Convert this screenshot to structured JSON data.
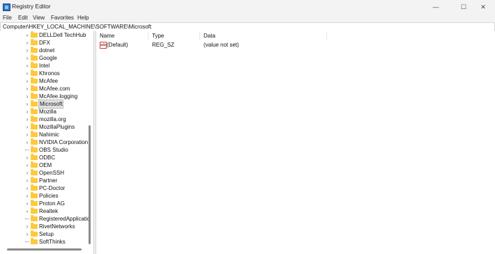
{
  "window": {
    "title": "Registry Editor"
  },
  "window_controls": {
    "minimize": "—",
    "maximize": "☐",
    "close": "✕"
  },
  "menu": [
    {
      "label": "File"
    },
    {
      "label": "Edit"
    },
    {
      "label": "View"
    },
    {
      "label": "Favorites"
    },
    {
      "label": "Help"
    }
  ],
  "address": "Computer\\HKEY_LOCAL_MACHINE\\SOFTWARE\\Microsoft",
  "tree": {
    "selected": "Microsoft",
    "items": [
      {
        "label": "DELLDell TechHub",
        "expandable": true
      },
      {
        "label": "DFX",
        "expandable": true
      },
      {
        "label": "dotnet",
        "expandable": true
      },
      {
        "label": "Google",
        "expandable": true
      },
      {
        "label": "Intel",
        "expandable": true
      },
      {
        "label": "Khronos",
        "expandable": true
      },
      {
        "label": "McAfee",
        "expandable": true
      },
      {
        "label": "McAfee.com",
        "expandable": true
      },
      {
        "label": "McAfee.logging",
        "expandable": true
      },
      {
        "label": "Microsoft",
        "expandable": true
      },
      {
        "label": "Mozilla",
        "expandable": true
      },
      {
        "label": "mozilla.org",
        "expandable": true
      },
      {
        "label": "MozillaPlugins",
        "expandable": true
      },
      {
        "label": "Nahimic",
        "expandable": true
      },
      {
        "label": "NVIDIA Corporation",
        "expandable": true
      },
      {
        "label": "OBS Studio",
        "expandable": false
      },
      {
        "label": "ODBC",
        "expandable": true
      },
      {
        "label": "OEM",
        "expandable": true
      },
      {
        "label": "OpenSSH",
        "expandable": true
      },
      {
        "label": "Partner",
        "expandable": true
      },
      {
        "label": "PC-Doctor",
        "expandable": true
      },
      {
        "label": "Policies",
        "expandable": true
      },
      {
        "label": "Proton AG",
        "expandable": true
      },
      {
        "label": "Realtek",
        "expandable": true
      },
      {
        "label": "RegisteredApplicatic",
        "expandable": false
      },
      {
        "label": "RivetNetworks",
        "expandable": true
      },
      {
        "label": "Setup",
        "expandable": true
      },
      {
        "label": "SoftThinks",
        "expandable": false
      }
    ]
  },
  "values": {
    "columns": {
      "name": "Name",
      "type": "Type",
      "data": "Data"
    },
    "rows": [
      {
        "icon": "string-value-icon",
        "icon_text": "ab",
        "name": "(Default)",
        "type": "REG_SZ",
        "data": "(value not set)"
      }
    ]
  }
}
